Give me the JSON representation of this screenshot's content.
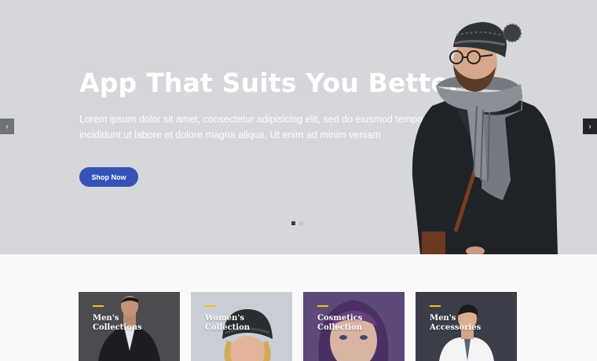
{
  "hero": {
    "title": "App That Suits You Better",
    "text": "Lorem ipsum dolor sit amet, consectetur adipisicing elit, sed do eiusmod tempor incididunt ut labore et dolore magna aliqua. Ut enim ad minim veniam",
    "button_label": "Shop Now",
    "prev_arrow": "‹",
    "next_arrow": "›",
    "slide_count": 2,
    "active_slide": 1,
    "colors": {
      "background": "#d5d7db",
      "button": "#3453b7"
    }
  },
  "categories": [
    {
      "title": "Men's Collections",
      "image": "man-in-leather-jacket"
    },
    {
      "title": "Women's Collection",
      "image": "woman-in-knit-hat"
    },
    {
      "title": "Cosmetics Collection",
      "image": "woman-face-closeup"
    },
    {
      "title": "Men's Accessories",
      "image": "man-in-shirt-and-tie"
    }
  ],
  "colors": {
    "accent_bar": "#f2c21a"
  }
}
